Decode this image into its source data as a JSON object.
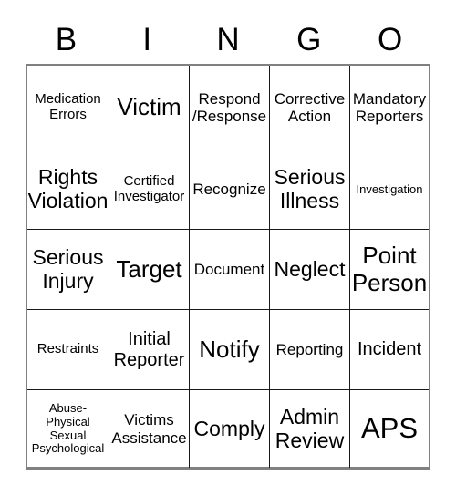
{
  "header": {
    "letters": [
      {
        "label": "B"
      },
      {
        "label": "I"
      },
      {
        "label": "N"
      },
      {
        "label": "G"
      },
      {
        "label": "O"
      }
    ]
  },
  "grid": {
    "columns": 5,
    "rows": 5,
    "cells": [
      {
        "text": "Medication\nErrors",
        "size": "fs-sm"
      },
      {
        "text": "Victim",
        "size": "fs-xxl"
      },
      {
        "text": "Respond\n/Response",
        "size": "fs-md"
      },
      {
        "text": "Corrective\nAction",
        "size": "fs-md"
      },
      {
        "text": "Mandatory\nReporters",
        "size": "fs-md"
      },
      {
        "text": "Rights\nViolation",
        "size": "fs-xl"
      },
      {
        "text": "Certified\nInvestigator",
        "size": "fs-sm"
      },
      {
        "text": "Recognize",
        "size": "fs-md"
      },
      {
        "text": "Serious\nIllness",
        "size": "fs-xl"
      },
      {
        "text": "Investigation",
        "size": "fs-xs"
      },
      {
        "text": "Serious\nInjury",
        "size": "fs-xl"
      },
      {
        "text": "Target",
        "size": "fs-xxl"
      },
      {
        "text": "Document",
        "size": "fs-md"
      },
      {
        "text": "Neglect",
        "size": "fs-xl"
      },
      {
        "text": "Point\nPerson",
        "size": "fs-xxl"
      },
      {
        "text": "Restraints",
        "size": "fs-sm"
      },
      {
        "text": "Initial\nReporter",
        "size": "fs-lg"
      },
      {
        "text": "Notify",
        "size": "fs-xxl"
      },
      {
        "text": "Reporting",
        "size": "fs-md"
      },
      {
        "text": "Incident",
        "size": "fs-lg"
      },
      {
        "text": "Abuse-\nPhysical\nSexual\nPsychological",
        "size": "fs-xs"
      },
      {
        "text": "Victims\nAssistance",
        "size": "fs-md"
      },
      {
        "text": "Comply",
        "size": "fs-xl"
      },
      {
        "text": "Admin\nReview",
        "size": "fs-xl"
      },
      {
        "text": "APS",
        "size": "fs-huge"
      }
    ]
  },
  "colors": {
    "background": "#ffffff",
    "text": "#000000",
    "cell_border": "#1a1a1a",
    "outer_border": "#808080"
  }
}
